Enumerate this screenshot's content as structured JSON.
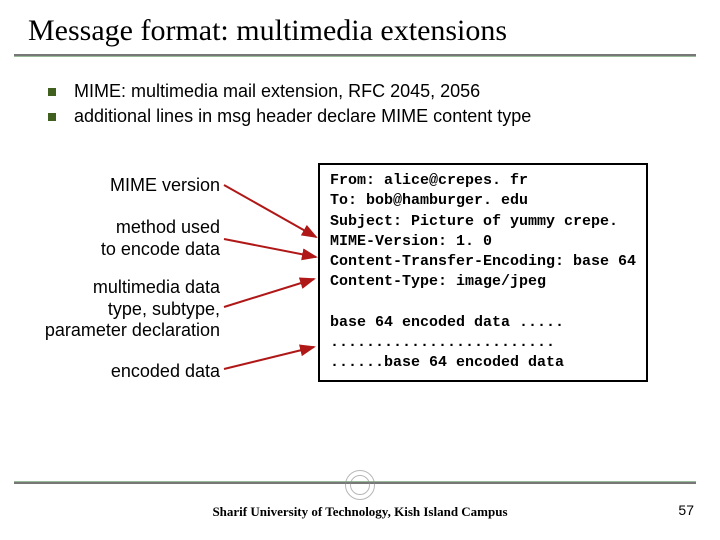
{
  "title": "Message format: multimedia extensions",
  "bullets": [
    "MIME: multimedia mail extension, RFC 2045, 2056",
    "additional lines in msg header declare MIME content type"
  ],
  "labels": {
    "version": "MIME version",
    "method": "method used\nto encode data",
    "type": "multimedia data\ntype, subtype,\nparameter declaration",
    "encoded": "encoded data"
  },
  "code": {
    "l1": "From: alice@crepes. fr",
    "l2": "To: bob@hamburger. edu",
    "l3": "Subject: Picture of yummy crepe.",
    "l4": "MIME-Version: 1. 0",
    "l5": "Content-Transfer-Encoding: base 64",
    "l6": "Content-Type: image/jpeg",
    "l7": "",
    "l8": "base 64 encoded data .....",
    "l9": ".........................",
    "l10": "......base 64 encoded data"
  },
  "footer": "Sharif University of Technology, Kish Island Campus",
  "page": "57"
}
